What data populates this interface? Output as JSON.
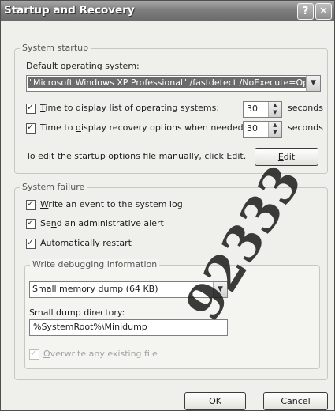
{
  "window": {
    "title": "Startup and Recovery"
  },
  "titlebar": {
    "help_glyph": "?",
    "close_glyph": "✕"
  },
  "startup": {
    "group_label": "System startup",
    "default_os_label_pre": "Default operating ",
    "default_os_label_ul": "s",
    "default_os_label_post": "ystem:",
    "default_os_value": "\"Microsoft Windows XP Professional\" /fastdetect /NoExecute=OptIn",
    "time_list_ul": "T",
    "time_list_rest": "ime to display list of operating systems:",
    "time_list_checked": true,
    "time_list_value": "30",
    "time_recovery_pre": "Time to ",
    "time_recovery_ul": "d",
    "time_recovery_post": "isplay recovery options when needed:",
    "time_recovery_checked": true,
    "time_recovery_value": "30",
    "seconds_label": "seconds",
    "edit_hint": "To edit the startup options file manually, click Edit.",
    "edit_button_ul": "E",
    "edit_button_rest": "dit"
  },
  "failure": {
    "group_label": "System failure",
    "write_event_ul": "W",
    "write_event_rest": "rite an event to the system log",
    "write_event_checked": true,
    "admin_alert_pre": "Se",
    "admin_alert_ul": "n",
    "admin_alert_post": "d an administrative alert",
    "admin_alert_checked": true,
    "auto_restart_pre": "Automatically ",
    "auto_restart_ul": "r",
    "auto_restart_post": "estart",
    "auto_restart_checked": true
  },
  "debug": {
    "group_label": "Write debugging information",
    "dump_type": "Small memory dump (64 KB)",
    "dump_dir_label": "Small dump directory:",
    "dump_dir_value": "%SystemRoot%\\Minidump",
    "overwrite_ul": "O",
    "overwrite_rest": "verwrite any existing file",
    "overwrite_checked": true,
    "overwrite_disabled": true
  },
  "footer": {
    "ok_label": "OK",
    "cancel_label": "Cancel"
  },
  "watermark": {
    "text": "92333"
  },
  "colors": {
    "titlebar": "#7e7e7e",
    "dialog_bg": "#efefeb",
    "selection": "#6b6b6b",
    "watermark": "#1a1a1a"
  },
  "icons": {
    "dropdown": "chevron-down-icon",
    "spin_up": "arrow-up-icon",
    "spin_down": "arrow-down-icon",
    "check": "checkmark-icon"
  }
}
